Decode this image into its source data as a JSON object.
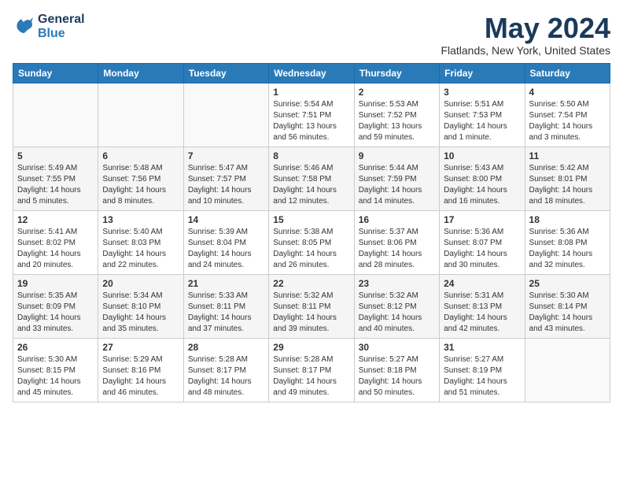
{
  "header": {
    "logo_line1": "General",
    "logo_line2": "Blue",
    "month_title": "May 2024",
    "location": "Flatlands, New York, United States"
  },
  "weekdays": [
    "Sunday",
    "Monday",
    "Tuesday",
    "Wednesday",
    "Thursday",
    "Friday",
    "Saturday"
  ],
  "weeks": [
    [
      {
        "num": "",
        "sunrise": "",
        "sunset": "",
        "daylight": ""
      },
      {
        "num": "",
        "sunrise": "",
        "sunset": "",
        "daylight": ""
      },
      {
        "num": "",
        "sunrise": "",
        "sunset": "",
        "daylight": ""
      },
      {
        "num": "1",
        "sunrise": "Sunrise: 5:54 AM",
        "sunset": "Sunset: 7:51 PM",
        "daylight": "Daylight: 13 hours and 56 minutes."
      },
      {
        "num": "2",
        "sunrise": "Sunrise: 5:53 AM",
        "sunset": "Sunset: 7:52 PM",
        "daylight": "Daylight: 13 hours and 59 minutes."
      },
      {
        "num": "3",
        "sunrise": "Sunrise: 5:51 AM",
        "sunset": "Sunset: 7:53 PM",
        "daylight": "Daylight: 14 hours and 1 minute."
      },
      {
        "num": "4",
        "sunrise": "Sunrise: 5:50 AM",
        "sunset": "Sunset: 7:54 PM",
        "daylight": "Daylight: 14 hours and 3 minutes."
      }
    ],
    [
      {
        "num": "5",
        "sunrise": "Sunrise: 5:49 AM",
        "sunset": "Sunset: 7:55 PM",
        "daylight": "Daylight: 14 hours and 5 minutes."
      },
      {
        "num": "6",
        "sunrise": "Sunrise: 5:48 AM",
        "sunset": "Sunset: 7:56 PM",
        "daylight": "Daylight: 14 hours and 8 minutes."
      },
      {
        "num": "7",
        "sunrise": "Sunrise: 5:47 AM",
        "sunset": "Sunset: 7:57 PM",
        "daylight": "Daylight: 14 hours and 10 minutes."
      },
      {
        "num": "8",
        "sunrise": "Sunrise: 5:46 AM",
        "sunset": "Sunset: 7:58 PM",
        "daylight": "Daylight: 14 hours and 12 minutes."
      },
      {
        "num": "9",
        "sunrise": "Sunrise: 5:44 AM",
        "sunset": "Sunset: 7:59 PM",
        "daylight": "Daylight: 14 hours and 14 minutes."
      },
      {
        "num": "10",
        "sunrise": "Sunrise: 5:43 AM",
        "sunset": "Sunset: 8:00 PM",
        "daylight": "Daylight: 14 hours and 16 minutes."
      },
      {
        "num": "11",
        "sunrise": "Sunrise: 5:42 AM",
        "sunset": "Sunset: 8:01 PM",
        "daylight": "Daylight: 14 hours and 18 minutes."
      }
    ],
    [
      {
        "num": "12",
        "sunrise": "Sunrise: 5:41 AM",
        "sunset": "Sunset: 8:02 PM",
        "daylight": "Daylight: 14 hours and 20 minutes."
      },
      {
        "num": "13",
        "sunrise": "Sunrise: 5:40 AM",
        "sunset": "Sunset: 8:03 PM",
        "daylight": "Daylight: 14 hours and 22 minutes."
      },
      {
        "num": "14",
        "sunrise": "Sunrise: 5:39 AM",
        "sunset": "Sunset: 8:04 PM",
        "daylight": "Daylight: 14 hours and 24 minutes."
      },
      {
        "num": "15",
        "sunrise": "Sunrise: 5:38 AM",
        "sunset": "Sunset: 8:05 PM",
        "daylight": "Daylight: 14 hours and 26 minutes."
      },
      {
        "num": "16",
        "sunrise": "Sunrise: 5:37 AM",
        "sunset": "Sunset: 8:06 PM",
        "daylight": "Daylight: 14 hours and 28 minutes."
      },
      {
        "num": "17",
        "sunrise": "Sunrise: 5:36 AM",
        "sunset": "Sunset: 8:07 PM",
        "daylight": "Daylight: 14 hours and 30 minutes."
      },
      {
        "num": "18",
        "sunrise": "Sunrise: 5:36 AM",
        "sunset": "Sunset: 8:08 PM",
        "daylight": "Daylight: 14 hours and 32 minutes."
      }
    ],
    [
      {
        "num": "19",
        "sunrise": "Sunrise: 5:35 AM",
        "sunset": "Sunset: 8:09 PM",
        "daylight": "Daylight: 14 hours and 33 minutes."
      },
      {
        "num": "20",
        "sunrise": "Sunrise: 5:34 AM",
        "sunset": "Sunset: 8:10 PM",
        "daylight": "Daylight: 14 hours and 35 minutes."
      },
      {
        "num": "21",
        "sunrise": "Sunrise: 5:33 AM",
        "sunset": "Sunset: 8:11 PM",
        "daylight": "Daylight: 14 hours and 37 minutes."
      },
      {
        "num": "22",
        "sunrise": "Sunrise: 5:32 AM",
        "sunset": "Sunset: 8:11 PM",
        "daylight": "Daylight: 14 hours and 39 minutes."
      },
      {
        "num": "23",
        "sunrise": "Sunrise: 5:32 AM",
        "sunset": "Sunset: 8:12 PM",
        "daylight": "Daylight: 14 hours and 40 minutes."
      },
      {
        "num": "24",
        "sunrise": "Sunrise: 5:31 AM",
        "sunset": "Sunset: 8:13 PM",
        "daylight": "Daylight: 14 hours and 42 minutes."
      },
      {
        "num": "25",
        "sunrise": "Sunrise: 5:30 AM",
        "sunset": "Sunset: 8:14 PM",
        "daylight": "Daylight: 14 hours and 43 minutes."
      }
    ],
    [
      {
        "num": "26",
        "sunrise": "Sunrise: 5:30 AM",
        "sunset": "Sunset: 8:15 PM",
        "daylight": "Daylight: 14 hours and 45 minutes."
      },
      {
        "num": "27",
        "sunrise": "Sunrise: 5:29 AM",
        "sunset": "Sunset: 8:16 PM",
        "daylight": "Daylight: 14 hours and 46 minutes."
      },
      {
        "num": "28",
        "sunrise": "Sunrise: 5:28 AM",
        "sunset": "Sunset: 8:17 PM",
        "daylight": "Daylight: 14 hours and 48 minutes."
      },
      {
        "num": "29",
        "sunrise": "Sunrise: 5:28 AM",
        "sunset": "Sunset: 8:17 PM",
        "daylight": "Daylight: 14 hours and 49 minutes."
      },
      {
        "num": "30",
        "sunrise": "Sunrise: 5:27 AM",
        "sunset": "Sunset: 8:18 PM",
        "daylight": "Daylight: 14 hours and 50 minutes."
      },
      {
        "num": "31",
        "sunrise": "Sunrise: 5:27 AM",
        "sunset": "Sunset: 8:19 PM",
        "daylight": "Daylight: 14 hours and 51 minutes."
      },
      {
        "num": "",
        "sunrise": "",
        "sunset": "",
        "daylight": ""
      }
    ]
  ]
}
